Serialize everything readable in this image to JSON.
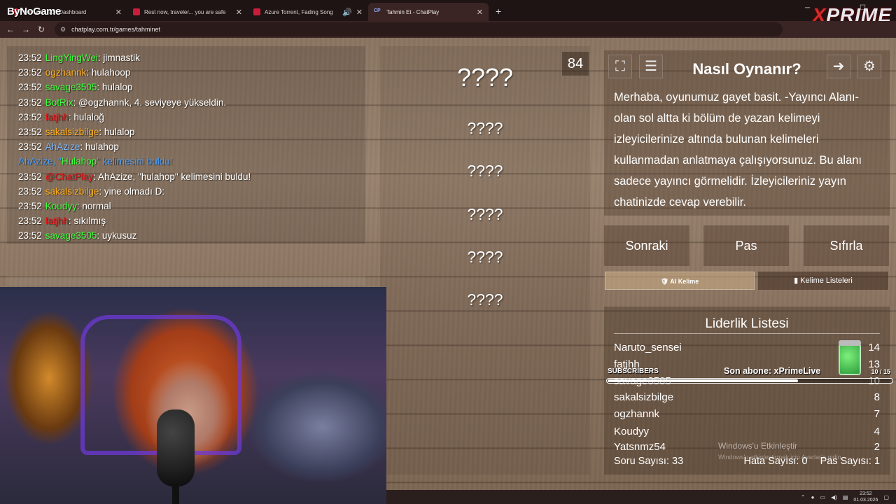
{
  "browser": {
    "brand": "ByNoGame",
    "tabs": [
      {
        "label": "Stream - Kick Dashboard",
        "active": false
      },
      {
        "label": "Rest now, traveler... you are safe",
        "active": false
      },
      {
        "label": "Azure Torrent, Fading Song",
        "active": false
      },
      {
        "label": "Tahmin Et - ChatPlay",
        "active": true
      }
    ],
    "new_tab": "+",
    "url": "chatplay.com.tr/games/tahminet",
    "overlay_logo_x": "X",
    "overlay_logo_rest": "PRIME"
  },
  "chat": {
    "messages": [
      {
        "time": "23:52",
        "user": "LingYingWei",
        "color": "green",
        "text": ": jimnastik"
      },
      {
        "time": "23:52",
        "user": "ogzhannk",
        "color": "orange",
        "text": ": hulahoop"
      },
      {
        "time": "23:52",
        "user": "savage3505",
        "color": "green",
        "text": ": hulalop"
      },
      {
        "time": "23:52",
        "user": "BotRix",
        "color": "green",
        "text": ": @ogzhannk, 4. seviyeye yükseldin."
      },
      {
        "time": "23:52",
        "user": "fatjhh",
        "color": "red",
        "text": ": hulaloğ"
      },
      {
        "time": "23:52",
        "user": "sakalsizbilge",
        "color": "orange",
        "text": ": hulalop"
      },
      {
        "time": "23:52",
        "user": "AhAzize",
        "color": "blue",
        "text": ": hulahop"
      },
      {
        "system": true,
        "before": "AhAzize, \"",
        "highlight": "Hulahop",
        "after": "\" kelimesini buldu!"
      },
      {
        "time": "23:52",
        "user": "@ChatPlay",
        "color": "red",
        "text": ": AhAzize, \"hulahop\" kelimesini buldu!"
      },
      {
        "time": "23:52",
        "user": "sakalsizbilge",
        "color": "orange",
        "text": ": yine olmadı D:"
      },
      {
        "time": "23:52",
        "user": "Koudyy",
        "color": "green",
        "text": ": normal"
      },
      {
        "time": "23:52",
        "user": "fatjhh",
        "color": "red",
        "text": ": sıkılmış"
      },
      {
        "time": "23:52",
        "user": "savage3505",
        "color": "green",
        "text": ": uykusuz"
      }
    ]
  },
  "game": {
    "timer": "84",
    "main_word": "????",
    "forbidden_words": [
      "????",
      "????",
      "????",
      "????",
      "????"
    ]
  },
  "howto": {
    "title": "Nasıl Oynanır?",
    "text": "Merhaba, oyunumuz gayet basit. -Yayıncı Alanı- olan sol altta ki bölüm de yazan kelimeyi izleyicilerinize altında bulunan kelimeleri kullanmadan anlatmaya çalışıyorsunuz. Bu alanı sadece yayıncı görmelidir. İzleyicileriniz yayın chatinizde cevap verebilir."
  },
  "actions": {
    "next": "Sonraki",
    "pass": "Pas",
    "reset": "Sıfırla",
    "ai_word": "AI Kelime",
    "word_lists": "Kelime Listeleri"
  },
  "leaderboard": {
    "title": "Liderlik Listesi",
    "rows": [
      {
        "name": "Naruto_sensei",
        "score": "14"
      },
      {
        "name": "fatjhh",
        "score": "13"
      },
      {
        "name": "savage3505",
        "score": "10"
      },
      {
        "name": "sakalsizbilge",
        "score": "8"
      },
      {
        "name": "ogzhannk",
        "score": "7"
      },
      {
        "name": "Koudyy",
        "score": "4"
      },
      {
        "name": "Yatsnmz54",
        "score": "2"
      }
    ],
    "questions": "Soru Sayısı: 33",
    "errors": "Hata Sayısı: 0",
    "passes": "Pas Sayısı: 1"
  },
  "subscribers": {
    "label": "SUBSCRIBERS",
    "last_sub": "Son abone: xPrimeLive",
    "count": "10 / 15",
    "progress": 0.667
  },
  "windows_activation": {
    "title": "Windows'u Etkinleştir",
    "subtitle": "Windows'u etkinleştirmek için Ayarlar'a gidin."
  },
  "taskbar": {
    "time": "23:52",
    "date": "01.03.2026"
  },
  "colors": {
    "green": "#3dff3d",
    "orange": "#ffb020",
    "blue": "#7fb8ff",
    "red": "#e01818"
  }
}
